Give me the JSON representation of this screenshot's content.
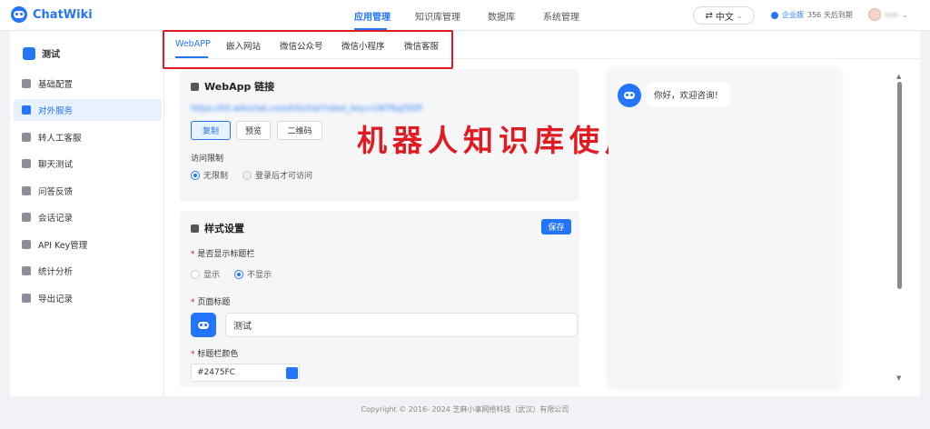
{
  "app": {
    "name": "ChatWiki"
  },
  "topnav": {
    "items": [
      "应用管理",
      "知识库管理",
      "数据库",
      "系统管理"
    ],
    "active": "应用管理"
  },
  "header": {
    "language": "中文",
    "edition_label": "企业版",
    "expiry": "356 天后到期",
    "username": "​nnn"
  },
  "sidebar": {
    "robot_name": "测试",
    "items": [
      {
        "label": "基础配置",
        "icon": "gear-icon"
      },
      {
        "label": "对外服务",
        "icon": "service-icon",
        "active": true
      },
      {
        "label": "转人工客服",
        "icon": "agent-icon"
      },
      {
        "label": "聊天测试",
        "icon": "chat-test-icon"
      },
      {
        "label": "问答反馈",
        "icon": "feedback-icon"
      },
      {
        "label": "会话记录",
        "icon": "history-icon"
      },
      {
        "label": "API Key管理",
        "icon": "api-key-icon"
      },
      {
        "label": "统计分析",
        "icon": "chart-icon"
      },
      {
        "label": "导出记录",
        "icon": "export-icon"
      }
    ]
  },
  "tabs": [
    "WebAPP",
    "嵌入网站",
    "微信公众号",
    "微信小程序",
    "微信客服"
  ],
  "webapp_card": {
    "title": "WebApp 链接",
    "url": "https://h5.wikichat.com/h5/chat?robot_key=1WTRqZ5DF",
    "copy": "复制",
    "preview": "预览",
    "qrcode": "二维码",
    "access_label": "访问限制",
    "access_options": [
      "无限制",
      "登录后才可访问"
    ]
  },
  "style_card": {
    "title": "样式设置",
    "save": "保存",
    "titlebar_label": "是否显示标题栏",
    "titlebar_options": [
      "显示",
      "不显示"
    ],
    "page_title_label": "页面标题",
    "page_title_value": "测试",
    "color_label": "标题栏颜色",
    "color_value": "#2475FC"
  },
  "overlay": {
    "text": "机器人知识库使用"
  },
  "preview": {
    "greeting": "你好，欢迎咨询！"
  },
  "footer": {
    "copyright": "Copyright © 2016- 2024 芝麻小事网络科技（武汉）有限公司"
  },
  "colors": {
    "accent": "#2475FC",
    "highlight_red": "#E11B22"
  }
}
